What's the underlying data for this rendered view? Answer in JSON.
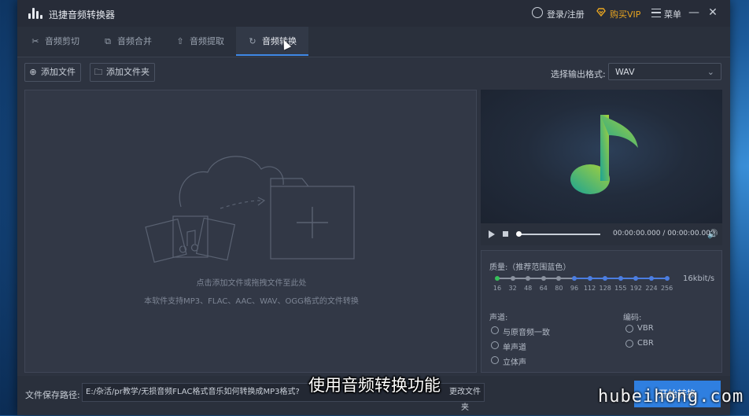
{
  "app": {
    "title": "迅捷音频转换器",
    "login_label": "登录/注册",
    "vip_label": "购买VIP",
    "menu_label": "菜单",
    "accent": "#2f7fe0",
    "vip_color": "#e8a520"
  },
  "tabs": [
    {
      "label": "音频剪切",
      "icon": "scissors-icon"
    },
    {
      "label": "音频合并",
      "icon": "merge-icon"
    },
    {
      "label": "音频提取",
      "icon": "upload-icon"
    },
    {
      "label": "音频转换",
      "icon": "refresh-icon",
      "active": true
    }
  ],
  "toolbar": {
    "add_file": "添加文件",
    "add_folder": "添加文件夹",
    "format_label": "选择输出格式:",
    "format_value": "WAV"
  },
  "dropzone": {
    "hint1": "点击添加文件或拖拽文件至此处",
    "hint2": "本软件支持MP3、FLAC、AAC、WAV、OGG格式的文件转换"
  },
  "player": {
    "time": "00:00:00.000 / 00:00:00.000",
    "progress": 0
  },
  "settings": {
    "quality_label": "质量:（推荐范围蓝色）",
    "bitrate_values": [
      "16",
      "32",
      "48",
      "64",
      "80",
      "96",
      "112",
      "128",
      "155",
      "192",
      "224",
      "256"
    ],
    "selected_bitrate": "16kbit/s",
    "channel_label": "声道:",
    "channel_options": [
      "与原音频一致",
      "单声道",
      "立体声"
    ],
    "encoding_label": "编码:",
    "encoding_options": [
      "VBR",
      "CBR"
    ]
  },
  "bottom": {
    "path_label": "文件保存路径:",
    "path_value": "E:/杂活/pr教学/无损音频FLAC格式音乐如何转换成MP3格式?",
    "change_label": "更改文件夹",
    "start_label": "开始转换"
  },
  "overlay": {
    "caption": "使用音频转换功能",
    "watermark": "hubeihong.com"
  }
}
